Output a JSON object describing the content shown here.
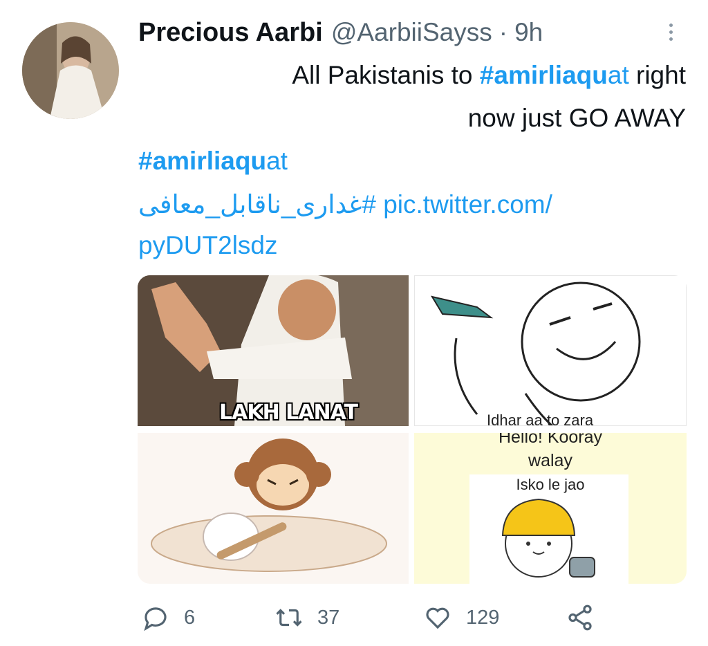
{
  "tweet": {
    "author_name": "Precious Aarbi",
    "handle": "@AarbiiSayss",
    "separator": "·",
    "time": "9h",
    "text_line1_prefix": "All Pakistanis to ",
    "hashtag1_bold": "#amirliaqu",
    "hashtag1_rest": "at",
    "text_line1_suffix": " right",
    "text_line2": "now just GO AWAY",
    "hashtag2_bold": "#amirliaqu",
    "hashtag2_rest": "at",
    "urdu_hashtag": "غداری_ناقابل_معافی#",
    "link_part1": "pic.twitter.com/",
    "link_part2": "pyDUT2lsdz"
  },
  "media": [
    {
      "caption": "LAKH LANAT"
    },
    {
      "caption": "Idhar aa to zara"
    },
    {
      "caption": ""
    },
    {
      "caption_line1": "Hello! Kooray",
      "caption_line2": "walay",
      "caption_line3": "Isko le jao"
    }
  ],
  "actions": {
    "replies": "6",
    "retweets": "37",
    "likes": "129"
  },
  "colors": {
    "accent": "#1d9bf0",
    "muted": "#536471",
    "text": "#0f1419"
  },
  "icons": [
    "more-icon",
    "reply-icon",
    "retweet-icon",
    "like-icon",
    "share-icon"
  ]
}
